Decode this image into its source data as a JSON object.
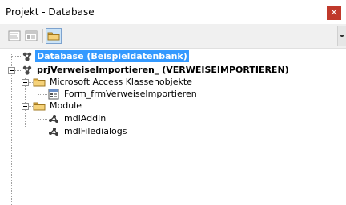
{
  "window": {
    "title": "Projekt - Database",
    "close_glyph": "×"
  },
  "toolbar": {
    "buttons": [
      {
        "name": "view-code",
        "icon": "view-code-icon"
      },
      {
        "name": "view-object",
        "icon": "view-object-icon"
      },
      {
        "name": "toggle-folders",
        "icon": "folder-icon",
        "active": true
      }
    ]
  },
  "tree": {
    "nodes": [
      {
        "label": "Database (Beispieldatenbank)",
        "icon": "vba-project-icon",
        "bold": true,
        "selected": true
      },
      {
        "label": "prjVerweiseImportieren_ (VERWEISEIMPORTIEREN)",
        "icon": "vba-project-icon",
        "bold": true,
        "expanded": true
      },
      {
        "label": "Microsoft Access Klassenobjekte",
        "icon": "folder-icon",
        "expanded": true
      },
      {
        "label": "Form_frmVerweiseImportieren",
        "icon": "form-class-icon"
      },
      {
        "label": "Module",
        "icon": "folder-icon",
        "expanded": true
      },
      {
        "label": "mdlAddIn",
        "icon": "module-icon"
      },
      {
        "label": "mdlFiledialogs",
        "icon": "module-icon"
      }
    ]
  },
  "colors": {
    "selection": "#3399ff",
    "close_button": "#c0392b",
    "toolbar_bg": "#f0f0f0"
  }
}
